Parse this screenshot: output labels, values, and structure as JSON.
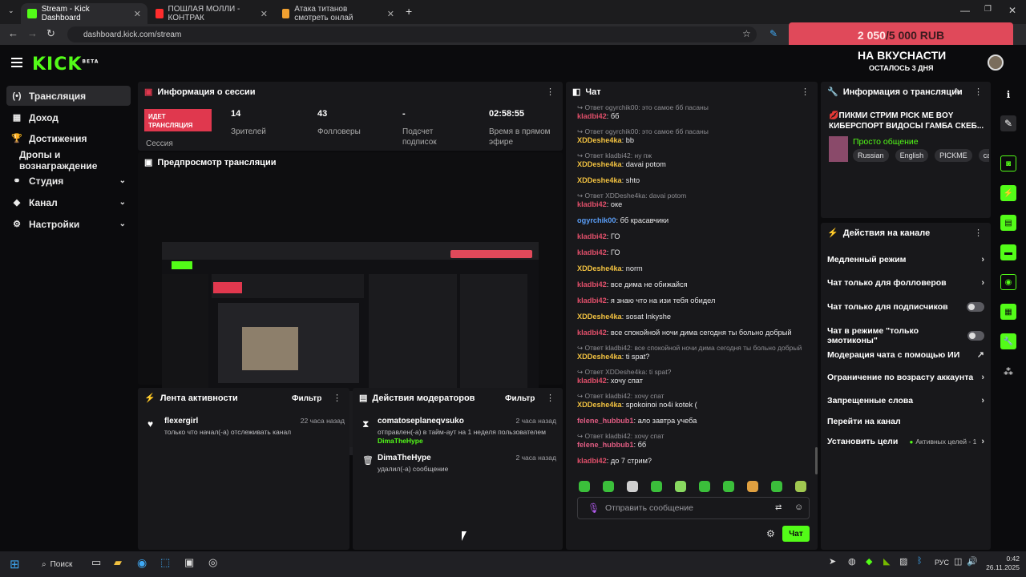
{
  "browser": {
    "tabs": [
      {
        "title": "Stream - Kick Dashboard",
        "color": "#53fc18"
      },
      {
        "title": "ПОШЛАЯ МОЛЛИ - КОНТРАК",
        "color": "#ff2d2d"
      },
      {
        "title": "Атака титанов смотреть онлай",
        "color": "#f0a030"
      }
    ],
    "new_tab": "+",
    "url": "dashboard.kick.com/stream"
  },
  "donation": {
    "current": "2 050",
    "separator": " / ",
    "goal": "5 000 RUB"
  },
  "overlay": {
    "title": "НА ВКУСНАСТИ",
    "subtitle": "ОСТАЛОСЬ 3 ДНЯ"
  },
  "logo": "KICK",
  "logo_beta": "BETA",
  "sidebar": {
    "items": [
      {
        "label": "Трансляция",
        "icon": "(•)",
        "active": true
      },
      {
        "label": "Доход",
        "icon": "▦"
      },
      {
        "label": "Достижения",
        "icon": "🏆"
      },
      {
        "label": "Дропы и вознаграждение",
        "icon": ""
      },
      {
        "label": "Студия",
        "icon": "⚭",
        "chevron": "⌄"
      },
      {
        "label": "Канал",
        "icon": "◆",
        "chevron": "⌄"
      },
      {
        "label": "Настройки",
        "icon": "⚙",
        "chevron": "⌄"
      }
    ]
  },
  "session": {
    "title": "Информация о сессии",
    "live_label": "ИДЕТ ТРАНСЛЯЦИЯ",
    "session_label": "Сессия",
    "stats": [
      {
        "value": "14",
        "label": "Зрителей"
      },
      {
        "value": "43",
        "label": "Фолловеры"
      },
      {
        "value": "-",
        "label": "Подсчет подписок"
      },
      {
        "value": "02:58:55",
        "label": "Время в прямом эфире"
      }
    ]
  },
  "preview": {
    "title": "Предпросмотр трансляции"
  },
  "activity": {
    "title": "Лента активности",
    "filter": "Фильтр",
    "items": [
      {
        "name": "flexergirl",
        "desc": "только что начал(-а) отслеживать канал",
        "time": "22 часа назад"
      }
    ]
  },
  "mod_actions": {
    "title": "Действия модераторов",
    "filter": "Фильтр",
    "items": [
      {
        "name": "comatoseplaneqvsuko",
        "desc": "отправлен(-а) в тайм-аут на 1 неделя пользователем",
        "target": "DimaTheHype",
        "time": "2 часа назад"
      },
      {
        "name": "DimaTheHype",
        "desc": "удалил(-а) сообщение",
        "target": "",
        "time": "2 часа назад"
      }
    ]
  },
  "chat": {
    "title": "Чат",
    "lines": [
      {
        "type": "reply",
        "text": "↪ Ответ ogyrchik00: это самое бб пасаны"
      },
      {
        "type": "msg",
        "user": "kladbi42",
        "color": "red",
        "text": "бб"
      },
      {
        "type": "reply",
        "text": "↪ Ответ ogyrchik00: это самое бб пасаны"
      },
      {
        "type": "msg",
        "user": "XDDeshe4ka",
        "color": "yel",
        "text": "bb"
      },
      {
        "type": "reply",
        "text": "↪ Ответ kladbi42: ну пж"
      },
      {
        "type": "msg",
        "user": "XDDeshe4ka",
        "color": "yel",
        "text": "davai potom"
      },
      {
        "type": "msg",
        "user": "XDDeshe4ka",
        "color": "yel",
        "text": "shto"
      },
      {
        "type": "reply",
        "text": "↪ Ответ XDDeshe4ka: davai potom"
      },
      {
        "type": "msg",
        "user": "kladbi42",
        "color": "red",
        "text": "оке"
      },
      {
        "type": "msg",
        "user": "ogyrchik00",
        "color": "blu",
        "text": "бб красавчики"
      },
      {
        "type": "msg",
        "user": "kladbi42",
        "color": "red",
        "text": "ГО"
      },
      {
        "type": "msg",
        "user": "kladbi42",
        "color": "red",
        "text": "ГО"
      },
      {
        "type": "msg",
        "user": "XDDeshe4ka",
        "color": "yel",
        "text": "norm"
      },
      {
        "type": "msg",
        "user": "kladbi42",
        "color": "red",
        "text": "все дима не обижайся"
      },
      {
        "type": "msg",
        "user": "kladbi42",
        "color": "red",
        "text": "я знаю что на изи тебя обидел"
      },
      {
        "type": "msg",
        "user": "XDDeshe4ka",
        "color": "yel",
        "text": "sosat Inkyshe"
      },
      {
        "type": "msg",
        "user": "kladbi42",
        "color": "red",
        "text": "все спокойной ночи дима сегодня ты больно добрый"
      },
      {
        "type": "reply",
        "text": "↪ Ответ kladbi42: все спокойной ночи дима сегодня ты больно добрый"
      },
      {
        "type": "msg",
        "user": "XDDeshe4ka",
        "color": "yel",
        "text": "ti spat?"
      },
      {
        "type": "reply",
        "text": "↪ Ответ XDDeshe4ka: ti spat?"
      },
      {
        "type": "msg",
        "user": "kladbi42",
        "color": "red",
        "text": "хочу спат"
      },
      {
        "type": "reply",
        "text": "↪ Ответ kladbi42: хочу спат"
      },
      {
        "type": "msg",
        "user": "XDDeshe4ka",
        "color": "yel",
        "text": "spokoinoi no4i kotek ("
      },
      {
        "type": "msg",
        "user": "felene_hubbub1",
        "color": "pink",
        "text": "ало завтра учеба"
      },
      {
        "type": "reply",
        "text": "↪ Ответ kladbi42: хочу спат"
      },
      {
        "type": "msg",
        "user": "felene_hubbub1",
        "color": "pink",
        "text": "бб"
      },
      {
        "type": "msg",
        "user": "kladbi42",
        "color": "red",
        "text": "до 7 стрим?"
      }
    ],
    "placeholder": "Отправить сообщение",
    "send": "Чат"
  },
  "stream_info": {
    "title": "Информация о трансляции",
    "stream_title": "💋ПИКМИ СТРИМ PICK ME BOY КИБЕРСПОРТ ВИДОСЫ ГАМБА СКЕБ...",
    "category": "Просто общение",
    "tags": [
      "Russian",
      "English",
      "PICKME",
      "casin"
    ]
  },
  "channel_actions": {
    "title": "Действия на канале",
    "items": [
      {
        "label": "Медленный режим",
        "control": "›"
      },
      {
        "label": "Чат только для фолловеров",
        "control": "›"
      },
      {
        "label": "Чат только для подписчиков",
        "control": "toggle"
      },
      {
        "label": "Чат в режиме \"только эмотиконы\"",
        "control": "toggle"
      },
      {
        "label": "Модерация чата с помощью ИИ",
        "control": "↗"
      },
      {
        "label": "Ограничение по возрасту аккаунта",
        "control": "›"
      },
      {
        "label": "Запрещенные слова",
        "control": "›"
      },
      {
        "label": "Перейти на канал",
        "control": ""
      },
      {
        "label": "Установить цели",
        "control": "›",
        "extra": "Активных целей - 1"
      }
    ]
  },
  "taskbar": {
    "search": "Поиск",
    "lang": "РУС",
    "time": "0:42",
    "date": "26.11.2025"
  }
}
